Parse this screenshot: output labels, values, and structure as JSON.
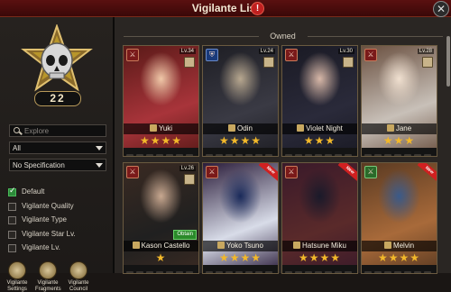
{
  "window": {
    "title": "Vigilante List",
    "info_icon": "!",
    "close_icon": "✕"
  },
  "profile": {
    "level": "22"
  },
  "search": {
    "placeholder": "Explore"
  },
  "filters": {
    "select_all": "All",
    "select_spec": "No Specification",
    "options": [
      {
        "label": "Default",
        "checked": true
      },
      {
        "label": "Vigilante Quality",
        "checked": false
      },
      {
        "label": "Vigilante Type",
        "checked": false
      },
      {
        "label": "Vigilante Star Lv.",
        "checked": false
      },
      {
        "label": "Vigilante Lv.",
        "checked": false
      }
    ]
  },
  "bottom_buttons": [
    {
      "label": "Vigilante Settings"
    },
    {
      "label": "Vigilante Fragments"
    },
    {
      "label": "Vigilante Council"
    }
  ],
  "section": {
    "label": "Owned"
  },
  "cards": [
    {
      "name": "Yuki",
      "level": "Lv.34",
      "stars": "★★★★",
      "role": "⚔",
      "role_color": "red",
      "art": [
        "#5a1a18",
        "#a8343a",
        "#f0c8a8"
      ]
    },
    {
      "name": "Odin",
      "level": "Lv.24",
      "stars": "★★★★",
      "role": "⛨",
      "role_color": "blue",
      "art": [
        "#1e1e24",
        "#3a3a44",
        "#b8a890"
      ]
    },
    {
      "name": "Violet Night",
      "level": "Lv.30",
      "stars": "★★★",
      "role": "⚔",
      "role_color": "red",
      "art": [
        "#1a1a24",
        "#2a2a3a",
        "#d8b8a8"
      ]
    },
    {
      "name": "Jane",
      "level": "Lv.28",
      "stars": "★★★",
      "role": "⚔",
      "role_color": "red",
      "art": [
        "#6a5040",
        "#c8c0b8",
        "#f0e0d0"
      ]
    },
    {
      "name": "Kason Castello",
      "level": "Lv.26",
      "stars": "★",
      "role": "⚔",
      "role_color": "red",
      "art": [
        "#3a2a22",
        "#202020",
        "#c8a890"
      ],
      "obtain": "Obtain"
    },
    {
      "name": "Yoko Tsuno",
      "level": "",
      "stars": "★★★★",
      "role": "⚔",
      "role_color": "red",
      "art": [
        "#2a1c3a",
        "#d8dce8",
        "#1a2a5a"
      ],
      "tag": "New"
    },
    {
      "name": "Hatsune Miku",
      "level": "",
      "stars": "★★★★",
      "role": "⚔",
      "role_color": "red",
      "art": [
        "#3a1a2a",
        "#5a2a2a",
        "#1a1a2a"
      ],
      "tag": "New"
    },
    {
      "name": "Melvin",
      "level": "",
      "stars": "★★★★",
      "role": "⚔",
      "role_color": "green",
      "art": [
        "#5a3a22",
        "#a86a3a",
        "#3a5a8a"
      ],
      "tag": "New"
    }
  ]
}
